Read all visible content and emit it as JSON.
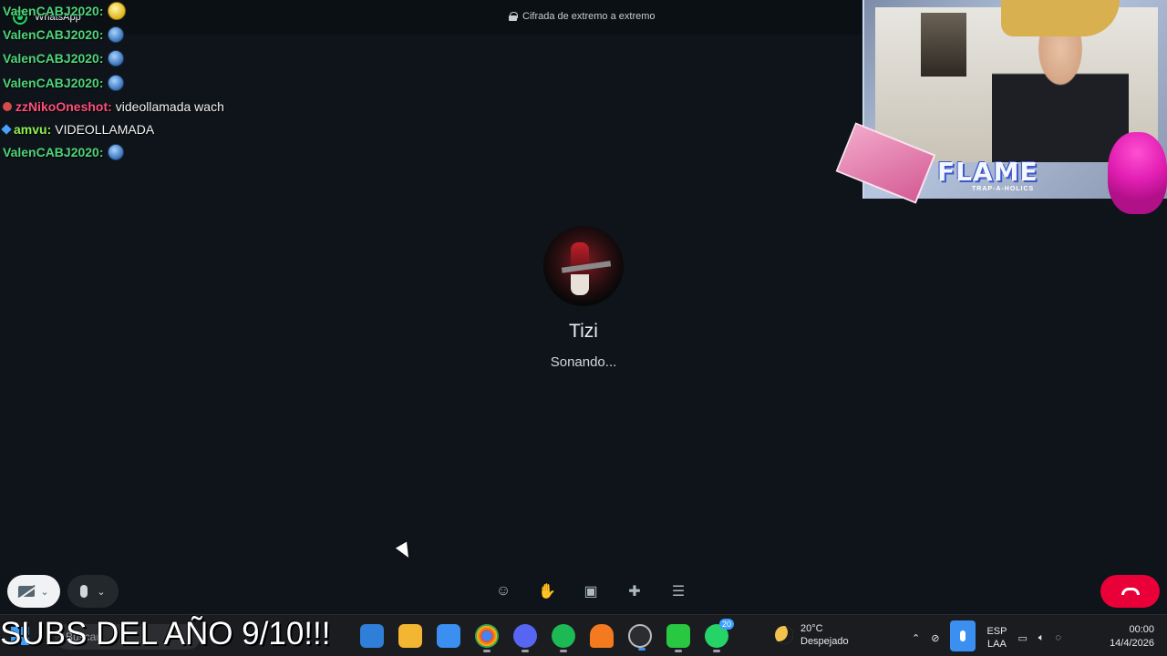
{
  "window": {
    "app_name": "WhatsApp",
    "encryption_notice": "Cifrada de extremo a extremo"
  },
  "chat_overlay": [
    {
      "user": "ValenCABJ2020:",
      "message": "",
      "user_color": "#4fd37a",
      "emote": "yellow-face-emote"
    },
    {
      "user": "ValenCABJ2020:",
      "message": "",
      "user_color": "#4fd37a",
      "emote": "globe-emote"
    },
    {
      "user": "ValenCABJ2020:",
      "message": "",
      "user_color": "#4fd37a",
      "emote": "globe-emote"
    },
    {
      "user": "ValenCABJ2020:",
      "message": "",
      "user_color": "#4fd37a",
      "emote": "globe-emote"
    },
    {
      "user": "zzNikoOneshot:",
      "message": "videollamada wach",
      "user_color": "#ff4f7a",
      "badge": "red"
    },
    {
      "user": "amvu:",
      "message": "VIDEOLLAMADA",
      "user_color": "#8ef04f",
      "badge": "blue"
    },
    {
      "user": "ValenCABJ2020:",
      "message": "",
      "user_color": "#4fd37a",
      "emote": "globe-emote"
    }
  ],
  "webcam_overlay": {
    "brand_text": "FLAME",
    "sub_text": "TRAP-A-HOLICS"
  },
  "call": {
    "contact_name": "Tizi",
    "status": "Sonando..."
  },
  "controls": {
    "video_chevron": "⌄",
    "mic_chevron": "⌄",
    "icons": [
      "emoji-icon",
      "raise-hand-icon",
      "share-screen-icon",
      "add-participant-icon",
      "more-options-icon"
    ]
  },
  "taskbar": {
    "search_placeholder": "Buscar",
    "weather_temp": "20°C",
    "weather_desc": "Despejado",
    "lang_top": "ESP",
    "lang_bottom": "LAA",
    "time": "00:00",
    "date": "14/4/2026",
    "whatsapp_badge": "20"
  },
  "stream_banner": "SUBS DEL AÑO 9/10!!!",
  "colors": {
    "end_call": "#ea0038",
    "accent_blue": "#3a8ff0"
  }
}
